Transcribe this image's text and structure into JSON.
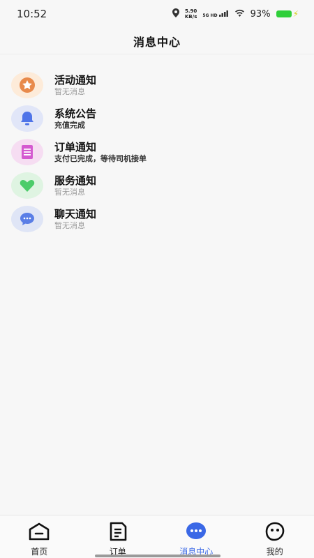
{
  "status_bar": {
    "time": "10:52",
    "net_speed_value": "5.90",
    "net_speed_unit": "KB/s",
    "signal_label": "5G HD",
    "battery_percent": "93%",
    "battery_level": 0.93,
    "battery_color": "#2fcf3a"
  },
  "header": {
    "title": "消息中心"
  },
  "messages": [
    {
      "title": "活动通知",
      "subtitle": "暂无消息",
      "icon": "star-icon",
      "bg": "#fdebd9",
      "color": "#e88a4b"
    },
    {
      "title": "系统公告",
      "subtitle": "充值完成",
      "icon": "bell-icon",
      "bg": "#e1e6f8",
      "color": "#4f74e8"
    },
    {
      "title": "订单通知",
      "subtitle": "支付已完成，等待司机接单",
      "icon": "list-icon",
      "bg": "#f6ddf2",
      "color": "#d45ad0"
    },
    {
      "title": "服务通知",
      "subtitle": "暂无消息",
      "icon": "heart-icon",
      "bg": "#dff4e2",
      "color": "#4ccc6a"
    },
    {
      "title": "聊天通知",
      "subtitle": "暂无消息",
      "icon": "chat-bubble-icon",
      "bg": "#dfe5f6",
      "color": "#5a7ee6"
    }
  ],
  "tabs": [
    {
      "label": "首页",
      "icon": "home-icon",
      "active": false
    },
    {
      "label": "订单",
      "icon": "order-icon",
      "active": false
    },
    {
      "label": "消息中心",
      "icon": "message-icon",
      "active": true
    },
    {
      "label": "我的",
      "icon": "profile-icon",
      "active": false
    }
  ],
  "colors": {
    "accent": "#3a68e6",
    "text": "#111111",
    "muted": "#999999"
  }
}
